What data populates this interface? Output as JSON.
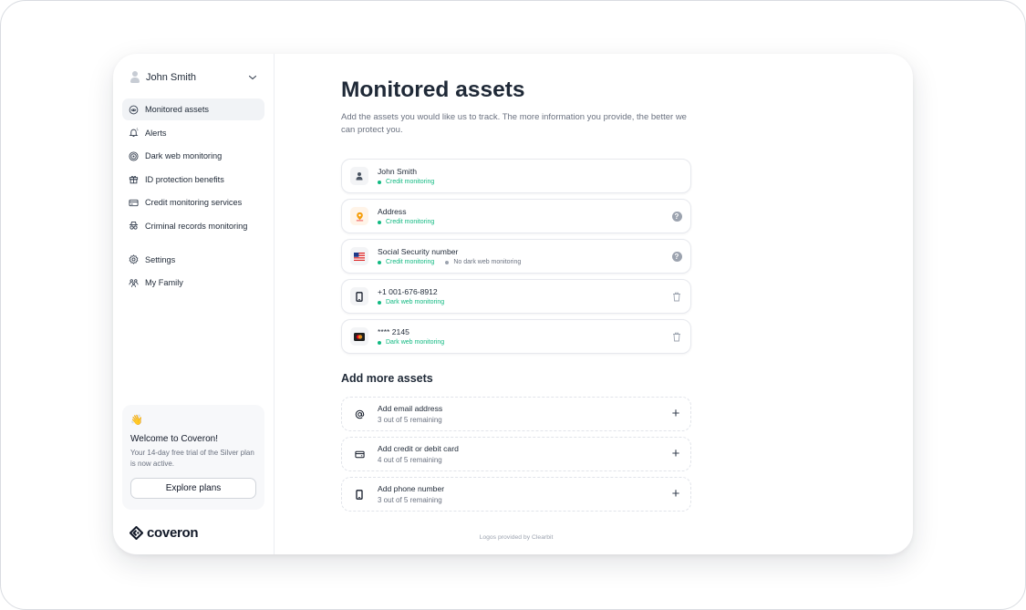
{
  "user": {
    "name": "John Smith"
  },
  "sidebar": {
    "items": [
      {
        "label": "Monitored assets",
        "icon": "eye-scan-icon",
        "active": true
      },
      {
        "label": "Alerts",
        "icon": "bell-icon"
      },
      {
        "label": "Dark web monitoring",
        "icon": "target-icon"
      },
      {
        "label": "ID protection benefits",
        "icon": "gift-icon"
      },
      {
        "label": "Credit monitoring services",
        "icon": "credit-card-icon"
      },
      {
        "label": "Criminal records monitoring",
        "icon": "detective-icon"
      }
    ],
    "secondary": [
      {
        "label": "Settings",
        "icon": "gear-icon"
      },
      {
        "label": "My Family",
        "icon": "family-icon"
      }
    ],
    "promo": {
      "emoji": "👋",
      "title": "Welcome to Coveron!",
      "text": "Your 14-day free trial of the Silver plan is now active.",
      "button": "Explore plans"
    },
    "brand": "coveron"
  },
  "main": {
    "title": "Monitored assets",
    "subtitle": "Add the assets you would like us to track. The more information you provide, the better we can protect you.",
    "assets": [
      {
        "title": "John Smith",
        "icon": "person-icon",
        "tags": [
          {
            "text": "Credit monitoring",
            "status": "green"
          }
        ]
      },
      {
        "title": "Address",
        "icon": "location-pin-icon",
        "tags": [
          {
            "text": "Credit monitoring",
            "status": "green"
          }
        ],
        "action": "help-icon"
      },
      {
        "title": "Social Security number",
        "icon": "us-flag-icon",
        "tags": [
          {
            "text": "Credit monitoring",
            "status": "green"
          },
          {
            "text": "No dark web monitoring",
            "status": "gray"
          }
        ],
        "action": "help-icon"
      },
      {
        "title": "+1 001-676-8912",
        "icon": "phone-icon",
        "tags": [
          {
            "text": "Dark web monitoring",
            "status": "green"
          }
        ],
        "action": "trash-icon"
      },
      {
        "title": "**** 2145",
        "icon": "mastercard-icon",
        "tags": [
          {
            "text": "Dark web monitoring",
            "status": "green"
          }
        ],
        "action": "trash-icon"
      }
    ],
    "add_section_title": "Add more assets",
    "add_items": [
      {
        "title": "Add email address",
        "sub": "3 out of 5 remaining",
        "icon": "at-sign-icon"
      },
      {
        "title": "Add credit or debit card",
        "sub": "4 out of 5 remaining",
        "icon": "card-icon"
      },
      {
        "title": "Add phone number",
        "sub": "3 out of 5 remaining",
        "icon": "phone-icon"
      }
    ],
    "footnote": "Logos provided by Clearbit"
  },
  "colors": {
    "accent_green": "#10b981",
    "text_dark": "#1f2937",
    "muted": "#6b7280"
  }
}
